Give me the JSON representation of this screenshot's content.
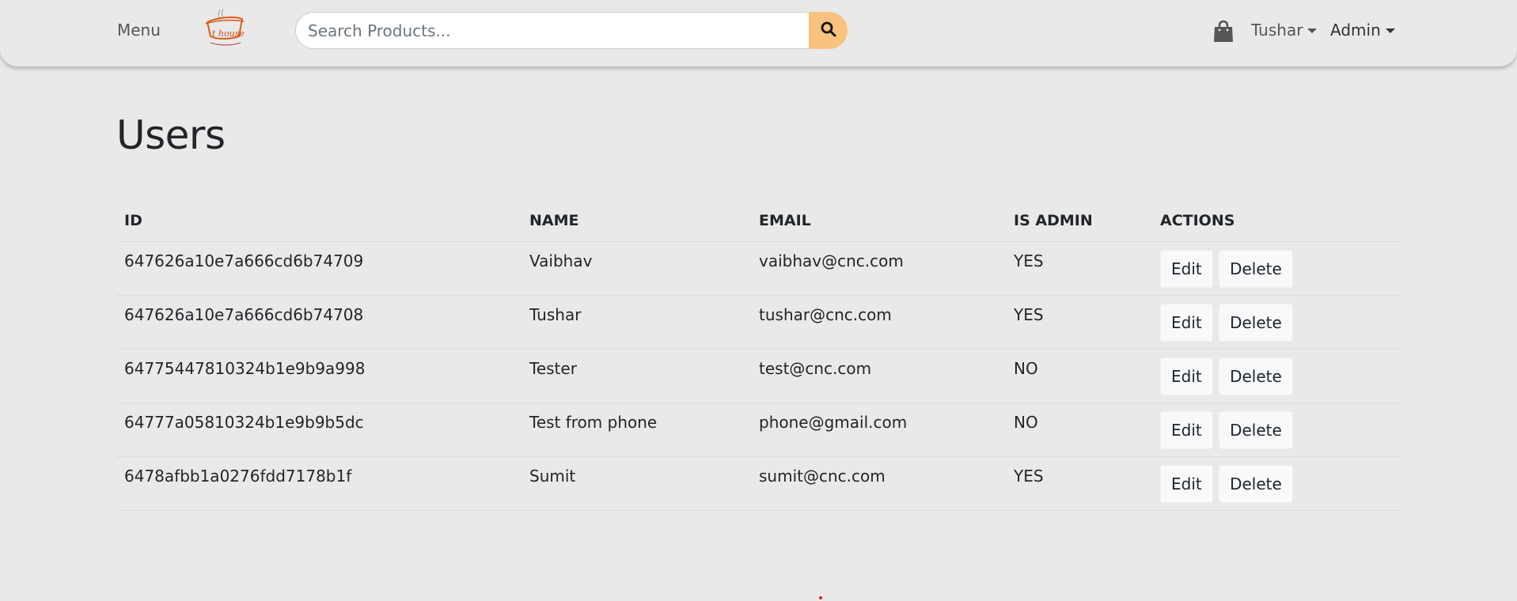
{
  "navbar": {
    "menu_label": "Menu",
    "logo_text": "t house",
    "search_placeholder": "Search Products...",
    "search_icon": "search-icon",
    "cart_icon": "shopping-bag-icon",
    "user_menu_label": "Tushar",
    "admin_menu_label": "Admin",
    "accent_color": "#f9c27e"
  },
  "main": {
    "title": "Users",
    "table": {
      "headers": [
        "ID",
        "NAME",
        "EMAIL",
        "IS ADMIN",
        "ACTIONS"
      ],
      "edit_label": "Edit",
      "delete_label": "Delete",
      "rows": [
        {
          "id": "647626a10e7a666cd6b74709",
          "name": "Vaibhav",
          "email": "vaibhav@cnc.com",
          "is_admin": "YES"
        },
        {
          "id": "647626a10e7a666cd6b74708",
          "name": "Tushar",
          "email": "tushar@cnc.com",
          "is_admin": "YES"
        },
        {
          "id": "64775447810324b1e9b9a998",
          "name": "Tester",
          "email": "test@cnc.com",
          "is_admin": "NO"
        },
        {
          "id": "64777a05810324b1e9b9b5dc",
          "name": "Test from phone",
          "email": "phone@gmail.com",
          "is_admin": "NO"
        },
        {
          "id": "6478afbb1a0276fdd7178b1f",
          "name": "Sumit",
          "email": "sumit@cnc.com",
          "is_admin": "YES"
        }
      ]
    }
  }
}
